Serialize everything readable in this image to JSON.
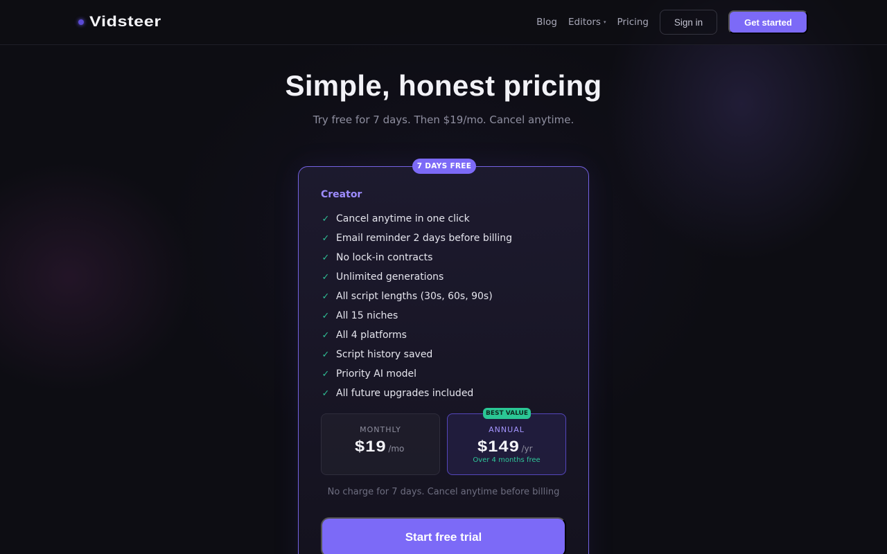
{
  "header": {
    "brand": "Vidsteer",
    "nav": {
      "blog": "Blog",
      "editors": "Editors",
      "pricing": "Pricing"
    },
    "sign_in": "Sign in",
    "get_started": "Get started"
  },
  "hero": {
    "title": "Simple, honest pricing",
    "subtitle": "Try free for 7 days. Then $19/mo. Cancel anytime."
  },
  "plan": {
    "badge": "7 DAYS FREE",
    "name": "Creator",
    "features": [
      "Cancel anytime in one click",
      "Email reminder 2 days before billing",
      "No lock-in contracts",
      "Unlimited generations",
      "All script lengths (30s, 60s, 90s)",
      "All 15 niches",
      "All 4 platforms",
      "Script history saved",
      "Priority AI model",
      "All future upgrades included"
    ],
    "billing": {
      "monthly": {
        "label": "MONTHLY",
        "price": "$19",
        "period": "/mo"
      },
      "annual": {
        "badge": "BEST VALUE",
        "label": "ANNUAL",
        "price": "$149",
        "period": "/yr",
        "note": "Over 4 months free",
        "selected": true
      }
    },
    "fineprint": "No charge for 7 days. Cancel anytime before billing",
    "cta": "Start free trial"
  },
  "colors": {
    "accent": "#7c6af7",
    "success": "#2fbf95",
    "background": "#0d0d13"
  },
  "icons": {
    "feature_check": "check-icon",
    "editors_dropdown": "chevron-down-icon"
  }
}
